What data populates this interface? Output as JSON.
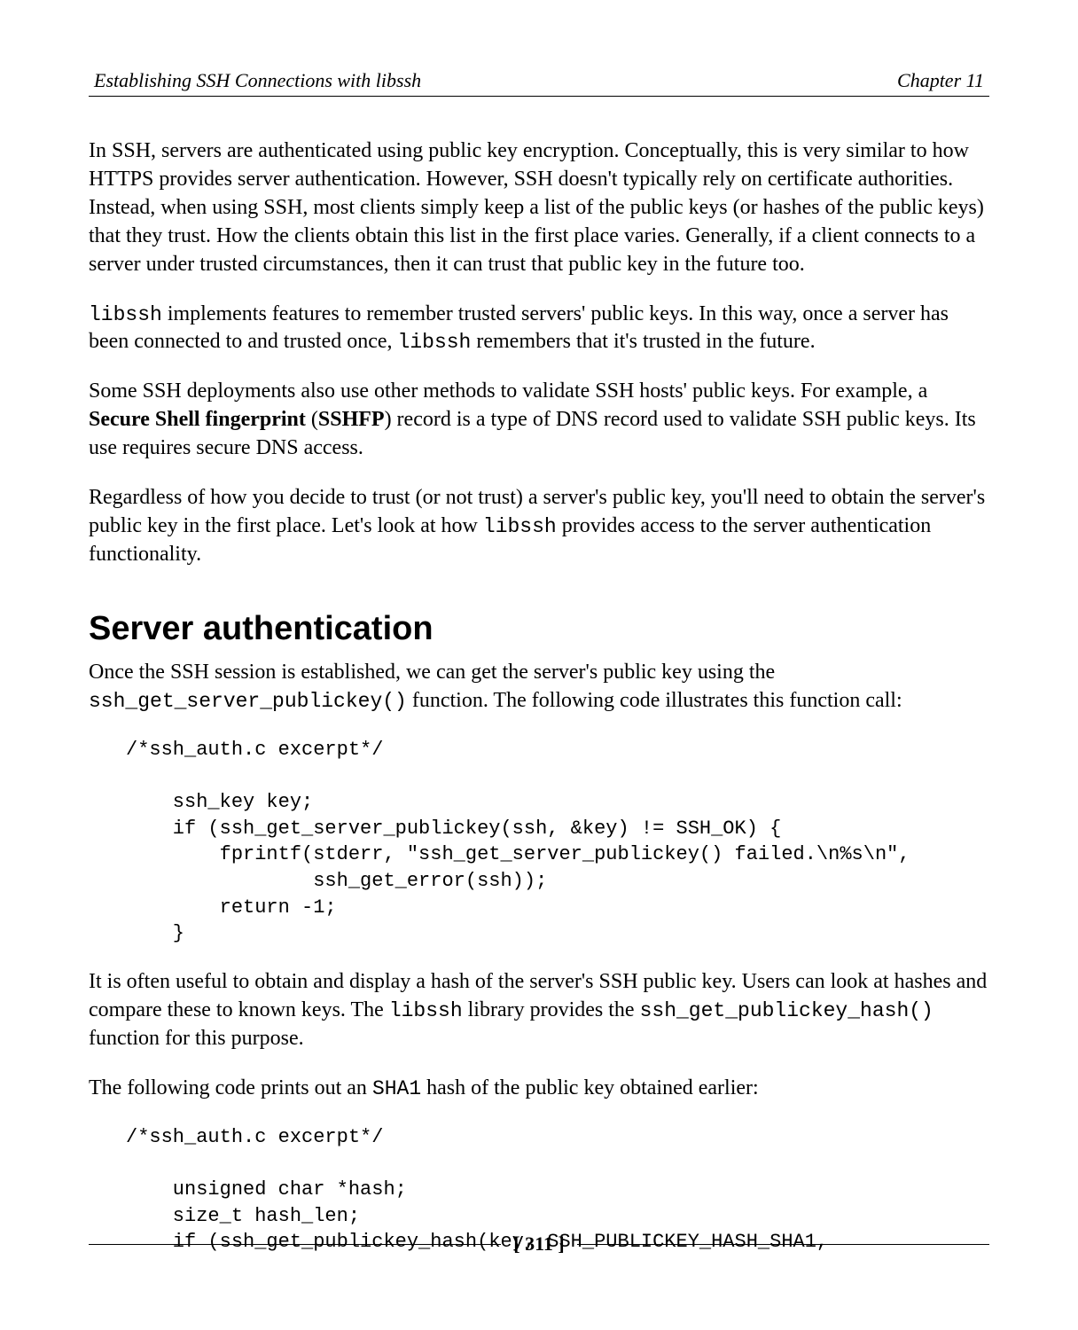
{
  "header": {
    "left": "Establishing SSH Connections with libssh",
    "right": "Chapter 11"
  },
  "para1": {
    "t1": "In SSH, servers are authenticated using public key encryption. Conceptually, this is very similar to how HTTPS provides server authentication. However, SSH doesn't typically rely on certificate authorities. Instead, when using SSH, most clients simply keep a list of the public keys (or hashes of the public keys) that they trust. How the clients obtain this list in the first place varies. Generally, if a client connects to a server under trusted circumstances, then it can trust that public key in the future too."
  },
  "para2": {
    "c1": "libssh",
    "t1": " implements features to remember trusted servers' public keys. In this way, once a server has been connected to and trusted once, ",
    "c2": "libssh",
    "t2": " remembers that it's trusted in the future."
  },
  "para3": {
    "t1": "Some SSH deployments also use other methods to validate SSH hosts' public keys. For example, a ",
    "b1": "Secure Shell fingerprint",
    "t2": " (",
    "b2": "SSHFP",
    "t3": ") record is a type of DNS record used to validate SSH public keys. Its use requires secure DNS access."
  },
  "para4": {
    "t1": "Regardless of how you decide to trust (or not trust) a server's public key, you'll need to obtain the server's public key in the first place. Let's look at how ",
    "c1": "libssh",
    "t2": " provides access to the server authentication functionality."
  },
  "section_heading": "Server authentication",
  "para5": {
    "t1": "Once the SSH session is established, we can get the server's public key using the ",
    "c1": "ssh_get_server_publickey()",
    "t2": " function. The following code illustrates this function call:"
  },
  "code1": "/*ssh_auth.c excerpt*/\n\n    ssh_key key;\n    if (ssh_get_server_publickey(ssh, &key) != SSH_OK) {\n        fprintf(stderr, \"ssh_get_server_publickey() failed.\\n%s\\n\",\n                ssh_get_error(ssh));\n        return -1;\n    }",
  "para6": {
    "t1": "It is often useful to obtain and display a hash of the server's SSH public key. Users can look at hashes and compare these to known keys. The ",
    "c1": "libssh",
    "t2": " library provides the ",
    "c2": "ssh_get_publickey_hash()",
    "t3": " function for this purpose."
  },
  "para7": {
    "t1": "The following code prints out an ",
    "c1": "SHA1",
    "t2": " hash of the public key obtained earlier:"
  },
  "code2": "/*ssh_auth.c excerpt*/\n\n    unsigned char *hash;\n    size_t hash_len;\n    if (ssh_get_publickey_hash(key, SSH_PUBLICKEY_HASH_SHA1,",
  "footer": {
    "page": "[ 311 ]"
  }
}
